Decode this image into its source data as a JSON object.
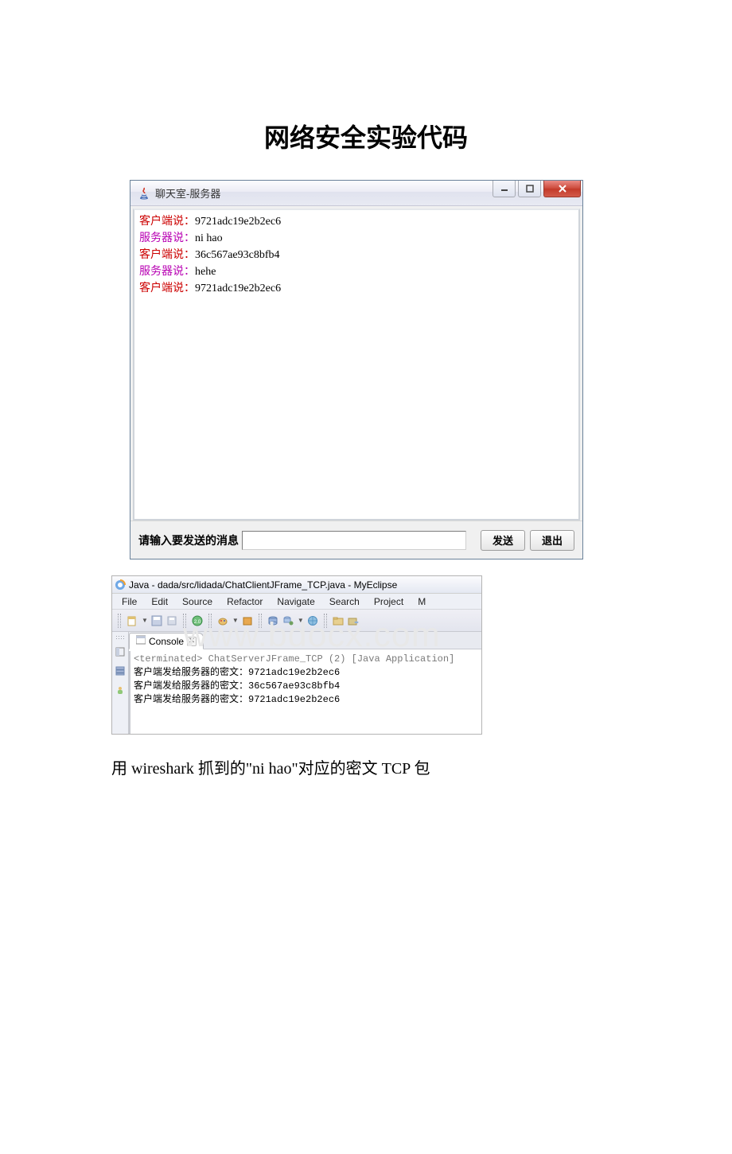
{
  "page_title": "网络安全实验代码",
  "chat_window": {
    "title": "聊天室-服务器",
    "messages": [
      {
        "prefix": "客户端说：",
        "value": "9721adc19e2b2ec6",
        "prefix_class": "c-red"
      },
      {
        "prefix": "服务器说：",
        "value": "ni hao",
        "prefix_class": "c-purple"
      },
      {
        "prefix": "客户端说：",
        "value": "36c567ae93c8bfb4",
        "prefix_class": "c-red"
      },
      {
        "prefix": "服务器说：",
        "value": "hehe",
        "prefix_class": "c-purple"
      },
      {
        "prefix": "客户端说：",
        "value": "9721adc19e2b2ec6",
        "prefix_class": "c-red"
      }
    ],
    "input_label": "请输入要发送的消息",
    "send_btn": "发送",
    "exit_btn": "退出"
  },
  "watermark": "www.bdocx.com",
  "eclipse": {
    "title": "Java - dada/src/lidada/ChatClientJFrame_TCP.java - MyEclipse",
    "menus": [
      "File",
      "Edit",
      "Source",
      "Refactor",
      "Navigate",
      "Search",
      "Project",
      "M"
    ],
    "console_tab": "Console",
    "term_line": "<terminated> ChatServerJFrame_TCP (2) [Java Application]",
    "lines": [
      "客户端发给服务器的密文：9721adc19e2b2ec6",
      "客户端发给服务器的密文：36c567ae93c8bfb4",
      "客户端发给服务器的密文：9721adc19e2b2ec6"
    ]
  },
  "caption": "用 wireshark 抓到的\"ni hao\"对应的密文 TCP 包"
}
